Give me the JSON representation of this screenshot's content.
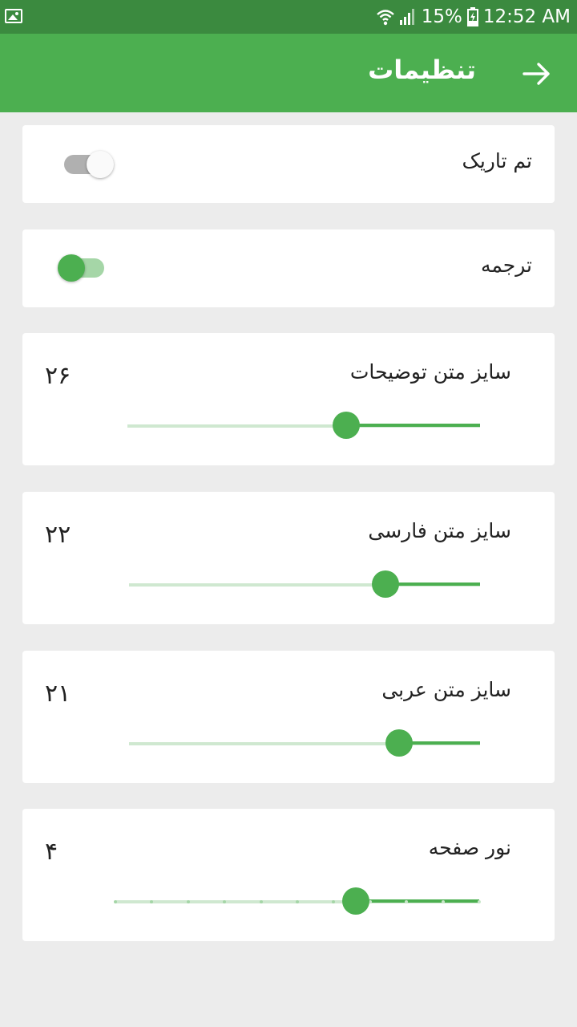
{
  "status_bar": {
    "battery": "15%",
    "time": "12:52 AM"
  },
  "app_bar": {
    "title": "تنظیمات"
  },
  "settings": [
    {
      "label": "تم تاریک",
      "type": "switch",
      "on": false
    },
    {
      "label": "ترجمه",
      "type": "switch",
      "on": true
    },
    {
      "label": "سایز متن توضیحات",
      "type": "slider",
      "value_text": "۲۶",
      "fraction": 0.62
    },
    {
      "label": "سایز متن فارسی",
      "type": "slider",
      "value_text": "۲۲",
      "fraction": 0.73
    },
    {
      "label": "سایز متن عربی",
      "type": "slider",
      "value_text": "۲۱",
      "fraction": 0.77
    },
    {
      "label": "نور صفحه",
      "type": "stepped-slider",
      "value_text": "۴",
      "steps": 10,
      "fraction": 0.66
    }
  ],
  "colors": {
    "accent": "#4caf50",
    "status_bar": "#3b8a3f",
    "background": "#ececec"
  }
}
